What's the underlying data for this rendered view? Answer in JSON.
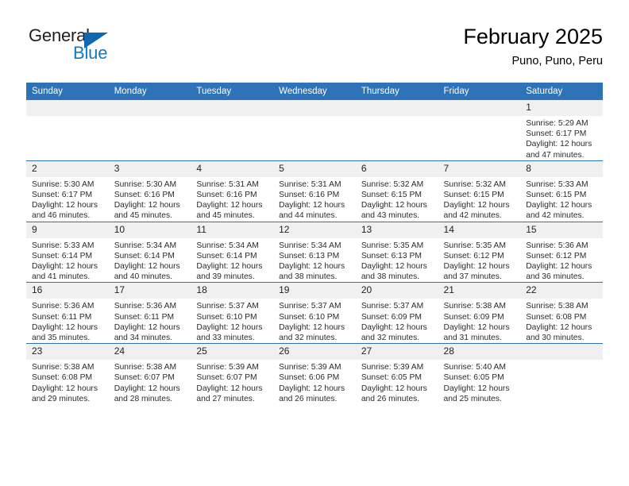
{
  "brand": {
    "name_part1": "General",
    "name_part2": "Blue",
    "triangle_icon": "brand-triangle-icon"
  },
  "header": {
    "title": "February 2025",
    "subtitle": "Puno, Puno, Peru"
  },
  "weekdays": [
    "Sunday",
    "Monday",
    "Tuesday",
    "Wednesday",
    "Thursday",
    "Friday",
    "Saturday"
  ],
  "colors": {
    "header_blue": "#2e72b8",
    "daynum_band": "#f0f0f0",
    "brand_blue": "#1279c6",
    "triangle_blue": "#1166b0",
    "text": "#000000"
  },
  "weeks": [
    [
      {
        "day": "",
        "blank": true,
        "sunrise": "",
        "sunset": "",
        "daylight1": "",
        "daylight2": ""
      },
      {
        "day": "",
        "blank": true,
        "sunrise": "",
        "sunset": "",
        "daylight1": "",
        "daylight2": ""
      },
      {
        "day": "",
        "blank": true,
        "sunrise": "",
        "sunset": "",
        "daylight1": "",
        "daylight2": ""
      },
      {
        "day": "",
        "blank": true,
        "sunrise": "",
        "sunset": "",
        "daylight1": "",
        "daylight2": ""
      },
      {
        "day": "",
        "blank": true,
        "sunrise": "",
        "sunset": "",
        "daylight1": "",
        "daylight2": ""
      },
      {
        "day": "",
        "blank": true,
        "sunrise": "",
        "sunset": "",
        "daylight1": "",
        "daylight2": ""
      },
      {
        "day": "1",
        "blank": false,
        "sunrise": "Sunrise: 5:29 AM",
        "sunset": "Sunset: 6:17 PM",
        "daylight1": "Daylight: 12 hours",
        "daylight2": "and 47 minutes."
      }
    ],
    [
      {
        "day": "2",
        "blank": false,
        "sunrise": "Sunrise: 5:30 AM",
        "sunset": "Sunset: 6:17 PM",
        "daylight1": "Daylight: 12 hours",
        "daylight2": "and 46 minutes."
      },
      {
        "day": "3",
        "blank": false,
        "sunrise": "Sunrise: 5:30 AM",
        "sunset": "Sunset: 6:16 PM",
        "daylight1": "Daylight: 12 hours",
        "daylight2": "and 45 minutes."
      },
      {
        "day": "4",
        "blank": false,
        "sunrise": "Sunrise: 5:31 AM",
        "sunset": "Sunset: 6:16 PM",
        "daylight1": "Daylight: 12 hours",
        "daylight2": "and 45 minutes."
      },
      {
        "day": "5",
        "blank": false,
        "sunrise": "Sunrise: 5:31 AM",
        "sunset": "Sunset: 6:16 PM",
        "daylight1": "Daylight: 12 hours",
        "daylight2": "and 44 minutes."
      },
      {
        "day": "6",
        "blank": false,
        "sunrise": "Sunrise: 5:32 AM",
        "sunset": "Sunset: 6:15 PM",
        "daylight1": "Daylight: 12 hours",
        "daylight2": "and 43 minutes."
      },
      {
        "day": "7",
        "blank": false,
        "sunrise": "Sunrise: 5:32 AM",
        "sunset": "Sunset: 6:15 PM",
        "daylight1": "Daylight: 12 hours",
        "daylight2": "and 42 minutes."
      },
      {
        "day": "8",
        "blank": false,
        "sunrise": "Sunrise: 5:33 AM",
        "sunset": "Sunset: 6:15 PM",
        "daylight1": "Daylight: 12 hours",
        "daylight2": "and 42 minutes."
      }
    ],
    [
      {
        "day": "9",
        "blank": false,
        "sunrise": "Sunrise: 5:33 AM",
        "sunset": "Sunset: 6:14 PM",
        "daylight1": "Daylight: 12 hours",
        "daylight2": "and 41 minutes."
      },
      {
        "day": "10",
        "blank": false,
        "sunrise": "Sunrise: 5:34 AM",
        "sunset": "Sunset: 6:14 PM",
        "daylight1": "Daylight: 12 hours",
        "daylight2": "and 40 minutes."
      },
      {
        "day": "11",
        "blank": false,
        "sunrise": "Sunrise: 5:34 AM",
        "sunset": "Sunset: 6:14 PM",
        "daylight1": "Daylight: 12 hours",
        "daylight2": "and 39 minutes."
      },
      {
        "day": "12",
        "blank": false,
        "sunrise": "Sunrise: 5:34 AM",
        "sunset": "Sunset: 6:13 PM",
        "daylight1": "Daylight: 12 hours",
        "daylight2": "and 38 minutes."
      },
      {
        "day": "13",
        "blank": false,
        "sunrise": "Sunrise: 5:35 AM",
        "sunset": "Sunset: 6:13 PM",
        "daylight1": "Daylight: 12 hours",
        "daylight2": "and 38 minutes."
      },
      {
        "day": "14",
        "blank": false,
        "sunrise": "Sunrise: 5:35 AM",
        "sunset": "Sunset: 6:12 PM",
        "daylight1": "Daylight: 12 hours",
        "daylight2": "and 37 minutes."
      },
      {
        "day": "15",
        "blank": false,
        "sunrise": "Sunrise: 5:36 AM",
        "sunset": "Sunset: 6:12 PM",
        "daylight1": "Daylight: 12 hours",
        "daylight2": "and 36 minutes."
      }
    ],
    [
      {
        "day": "16",
        "blank": false,
        "sunrise": "Sunrise: 5:36 AM",
        "sunset": "Sunset: 6:11 PM",
        "daylight1": "Daylight: 12 hours",
        "daylight2": "and 35 minutes."
      },
      {
        "day": "17",
        "blank": false,
        "sunrise": "Sunrise: 5:36 AM",
        "sunset": "Sunset: 6:11 PM",
        "daylight1": "Daylight: 12 hours",
        "daylight2": "and 34 minutes."
      },
      {
        "day": "18",
        "blank": false,
        "sunrise": "Sunrise: 5:37 AM",
        "sunset": "Sunset: 6:10 PM",
        "daylight1": "Daylight: 12 hours",
        "daylight2": "and 33 minutes."
      },
      {
        "day": "19",
        "blank": false,
        "sunrise": "Sunrise: 5:37 AM",
        "sunset": "Sunset: 6:10 PM",
        "daylight1": "Daylight: 12 hours",
        "daylight2": "and 32 minutes."
      },
      {
        "day": "20",
        "blank": false,
        "sunrise": "Sunrise: 5:37 AM",
        "sunset": "Sunset: 6:09 PM",
        "daylight1": "Daylight: 12 hours",
        "daylight2": "and 32 minutes."
      },
      {
        "day": "21",
        "blank": false,
        "sunrise": "Sunrise: 5:38 AM",
        "sunset": "Sunset: 6:09 PM",
        "daylight1": "Daylight: 12 hours",
        "daylight2": "and 31 minutes."
      },
      {
        "day": "22",
        "blank": false,
        "sunrise": "Sunrise: 5:38 AM",
        "sunset": "Sunset: 6:08 PM",
        "daylight1": "Daylight: 12 hours",
        "daylight2": "and 30 minutes."
      }
    ],
    [
      {
        "day": "23",
        "blank": false,
        "sunrise": "Sunrise: 5:38 AM",
        "sunset": "Sunset: 6:08 PM",
        "daylight1": "Daylight: 12 hours",
        "daylight2": "and 29 minutes."
      },
      {
        "day": "24",
        "blank": false,
        "sunrise": "Sunrise: 5:38 AM",
        "sunset": "Sunset: 6:07 PM",
        "daylight1": "Daylight: 12 hours",
        "daylight2": "and 28 minutes."
      },
      {
        "day": "25",
        "blank": false,
        "sunrise": "Sunrise: 5:39 AM",
        "sunset": "Sunset: 6:07 PM",
        "daylight1": "Daylight: 12 hours",
        "daylight2": "and 27 minutes."
      },
      {
        "day": "26",
        "blank": false,
        "sunrise": "Sunrise: 5:39 AM",
        "sunset": "Sunset: 6:06 PM",
        "daylight1": "Daylight: 12 hours",
        "daylight2": "and 26 minutes."
      },
      {
        "day": "27",
        "blank": false,
        "sunrise": "Sunrise: 5:39 AM",
        "sunset": "Sunset: 6:05 PM",
        "daylight1": "Daylight: 12 hours",
        "daylight2": "and 26 minutes."
      },
      {
        "day": "28",
        "blank": false,
        "sunrise": "Sunrise: 5:40 AM",
        "sunset": "Sunset: 6:05 PM",
        "daylight1": "Daylight: 12 hours",
        "daylight2": "and 25 minutes."
      },
      {
        "day": "",
        "blank": true,
        "sunrise": "",
        "sunset": "",
        "daylight1": "",
        "daylight2": ""
      }
    ]
  ]
}
